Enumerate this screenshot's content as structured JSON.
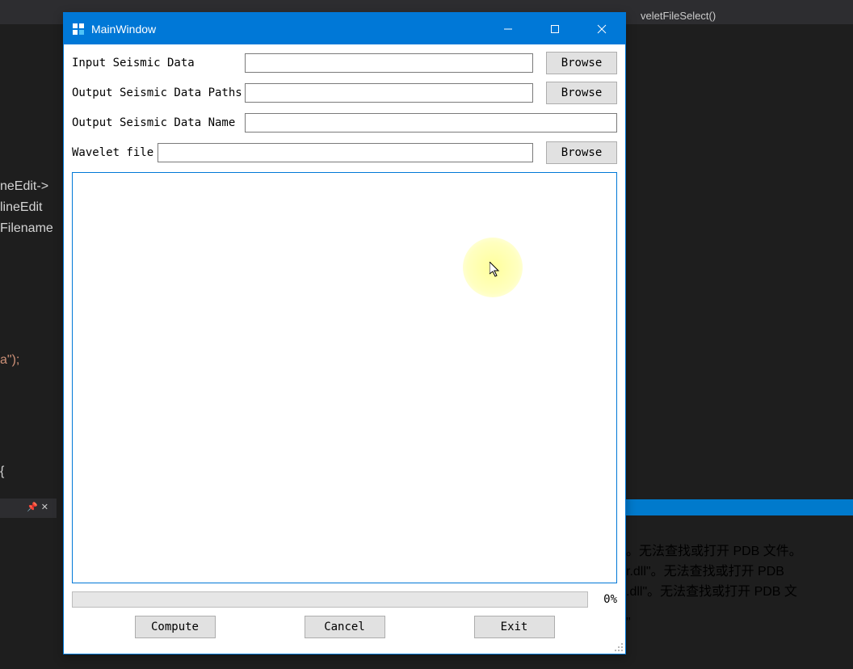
{
  "ide": {
    "topbar_func": "veletFileSelect()",
    "code_line1": "neEdit->",
    "code_line2": "lineEdit",
    "code_line3": "Filename",
    "code_line4": "a\");",
    "code_line5": "  {",
    "output_line1": "。无法查找或打开 PDB 文件。",
    "output_line2": "r.dll\"。无法查找或打开 PDB",
    "output_line3": ".dll\"。无法查找或打开 PDB 文",
    "output_line4": "\""
  },
  "window": {
    "title": "MainWindow"
  },
  "form": {
    "input_seismic_label": "Input Seismic Data",
    "input_seismic_value": "",
    "output_paths_label": "Output Seismic Data Paths",
    "output_paths_value": "",
    "output_name_label": "Output Seismic Data Name",
    "output_name_value": "",
    "wavelet_label": "Wavelet file",
    "wavelet_value": "",
    "browse_label": "Browse"
  },
  "progress": {
    "percent_label": "0%"
  },
  "buttons": {
    "compute": "Compute",
    "cancel": "Cancel",
    "exit": "Exit"
  }
}
